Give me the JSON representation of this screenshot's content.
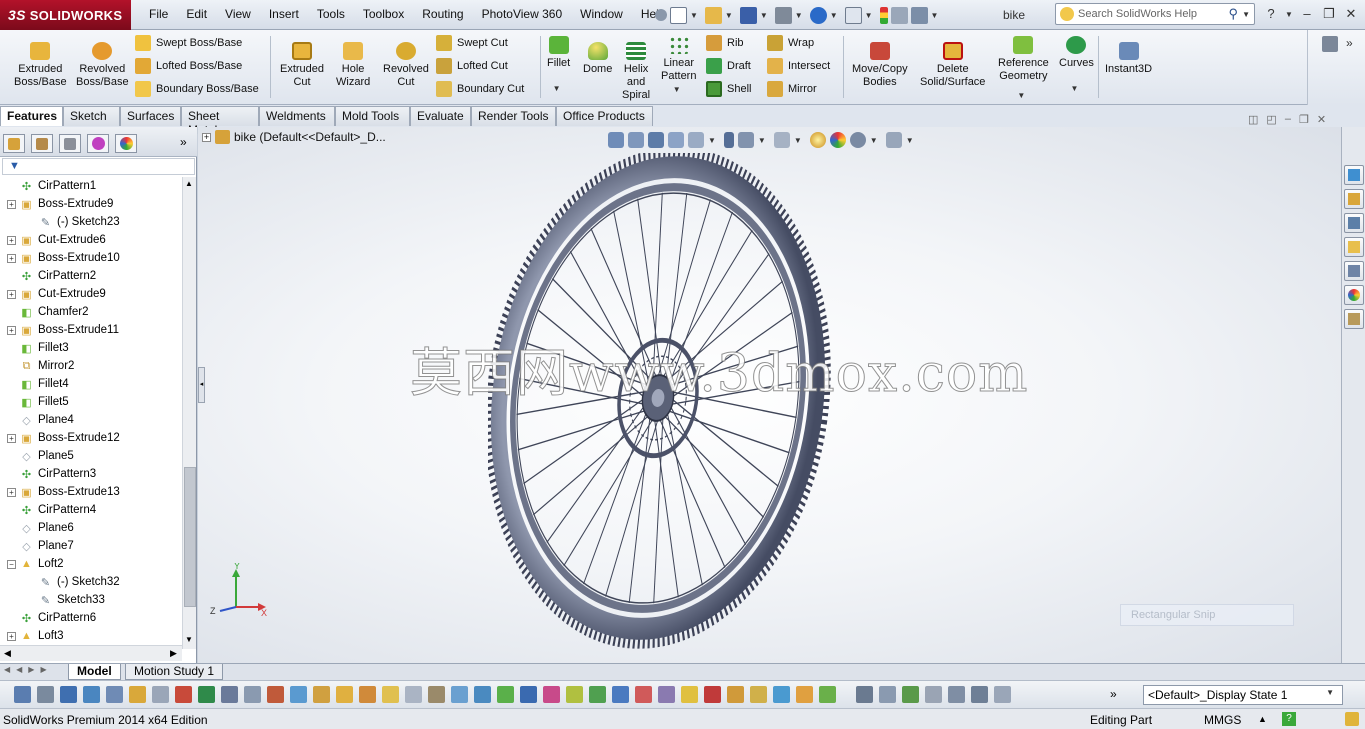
{
  "app": {
    "brand": "SOLIDWORKS",
    "brand_prefix": "3S",
    "doc_title": "bike",
    "accent": "#b3122a"
  },
  "menu": [
    "File",
    "Edit",
    "View",
    "Insert",
    "Tools",
    "Toolbox",
    "Routing",
    "PhotoView 360",
    "Window",
    "Help"
  ],
  "search": {
    "placeholder": "Search SolidWorks Help"
  },
  "ribbon": {
    "extruded_boss": "Extruded\nBoss/Base",
    "revolved_boss": "Revolved\nBoss/Base",
    "swept_boss": "Swept Boss/Base",
    "lofted_boss": "Lofted Boss/Base",
    "boundary_boss": "Boundary Boss/Base",
    "extruded_cut": "Extruded\nCut",
    "hole_wizard": "Hole\nWizard",
    "revolved_cut": "Revolved\nCut",
    "swept_cut": "Swept Cut",
    "lofted_cut": "Lofted Cut",
    "boundary_cut": "Boundary Cut",
    "fillet": "Fillet",
    "dome": "Dome",
    "helix": "Helix\nand\nSpiral",
    "linear_pattern": "Linear\nPattern",
    "rib": "Rib",
    "draft": "Draft",
    "shell": "Shell",
    "wrap": "Wrap",
    "intersect": "Intersect",
    "mirror": "Mirror",
    "move_copy": "Move/Copy\nBodies",
    "delete_solid": "Delete\nSolid/Surface",
    "ref_geometry": "Reference\nGeometry",
    "curves": "Curves",
    "instant3d": "Instant3D"
  },
  "tabs": [
    "Features",
    "Sketch",
    "Surfaces",
    "Sheet Metal",
    "Weldments",
    "Mold Tools",
    "Evaluate",
    "Render Tools",
    "Office Products"
  ],
  "tree": [
    {
      "label": "CirPattern1",
      "exp": false,
      "indent": 1,
      "icon": "pattern"
    },
    {
      "label": "Boss-Extrude9",
      "exp": true,
      "indent": 1,
      "icon": "boss"
    },
    {
      "label": "(-) Sketch23",
      "exp": false,
      "indent": 2,
      "icon": "sketch"
    },
    {
      "label": "Cut-Extrude6",
      "exp": true,
      "indent": 1,
      "icon": "cut"
    },
    {
      "label": "Boss-Extrude10",
      "exp": true,
      "indent": 1,
      "icon": "boss"
    },
    {
      "label": "CirPattern2",
      "exp": false,
      "indent": 1,
      "icon": "pattern"
    },
    {
      "label": "Cut-Extrude9",
      "exp": true,
      "indent": 1,
      "icon": "cut"
    },
    {
      "label": "Chamfer2",
      "exp": false,
      "indent": 1,
      "icon": "fillet"
    },
    {
      "label": "Boss-Extrude11",
      "exp": true,
      "indent": 1,
      "icon": "boss"
    },
    {
      "label": "Fillet3",
      "exp": false,
      "indent": 1,
      "icon": "fillet"
    },
    {
      "label": "Mirror2",
      "exp": false,
      "indent": 1,
      "icon": "mirror"
    },
    {
      "label": "Fillet4",
      "exp": false,
      "indent": 1,
      "icon": "fillet"
    },
    {
      "label": "Fillet5",
      "exp": false,
      "indent": 1,
      "icon": "fillet"
    },
    {
      "label": "Plane4",
      "exp": false,
      "indent": 1,
      "icon": "plane"
    },
    {
      "label": "Boss-Extrude12",
      "exp": true,
      "indent": 1,
      "icon": "boss"
    },
    {
      "label": "Plane5",
      "exp": false,
      "indent": 1,
      "icon": "plane"
    },
    {
      "label": "CirPattern3",
      "exp": false,
      "indent": 1,
      "icon": "pattern"
    },
    {
      "label": "Boss-Extrude13",
      "exp": true,
      "indent": 1,
      "icon": "boss"
    },
    {
      "label": "CirPattern4",
      "exp": false,
      "indent": 1,
      "icon": "pattern"
    },
    {
      "label": "Plane6",
      "exp": false,
      "indent": 1,
      "icon": "plane"
    },
    {
      "label": "Plane7",
      "exp": false,
      "indent": 1,
      "icon": "plane"
    },
    {
      "label": "Loft2",
      "exp": "open",
      "indent": 1,
      "icon": "loft"
    },
    {
      "label": "(-) Sketch32",
      "exp": false,
      "indent": 2,
      "icon": "sketch"
    },
    {
      "label": "Sketch33",
      "exp": false,
      "indent": 2,
      "icon": "sketch"
    },
    {
      "label": "CirPattern6",
      "exp": false,
      "indent": 1,
      "icon": "pattern"
    },
    {
      "label": "Loft3",
      "exp": true,
      "indent": 1,
      "icon": "loft"
    }
  ],
  "viewport": {
    "title": "bike  (Default<<Default>_D...",
    "watermark": "莫西网www.3dmox.com",
    "snip": "Rectangular Snip",
    "axes": {
      "x": "X",
      "y": "Y",
      "z": "Z"
    }
  },
  "bottom_tabs": [
    "Model",
    "Motion Study 1"
  ],
  "display_state": "<Default>_Display State 1",
  "status": {
    "edition": "SolidWorks Premium 2014 x64 Edition",
    "mode": "Editing Part",
    "units": "MMGS"
  }
}
